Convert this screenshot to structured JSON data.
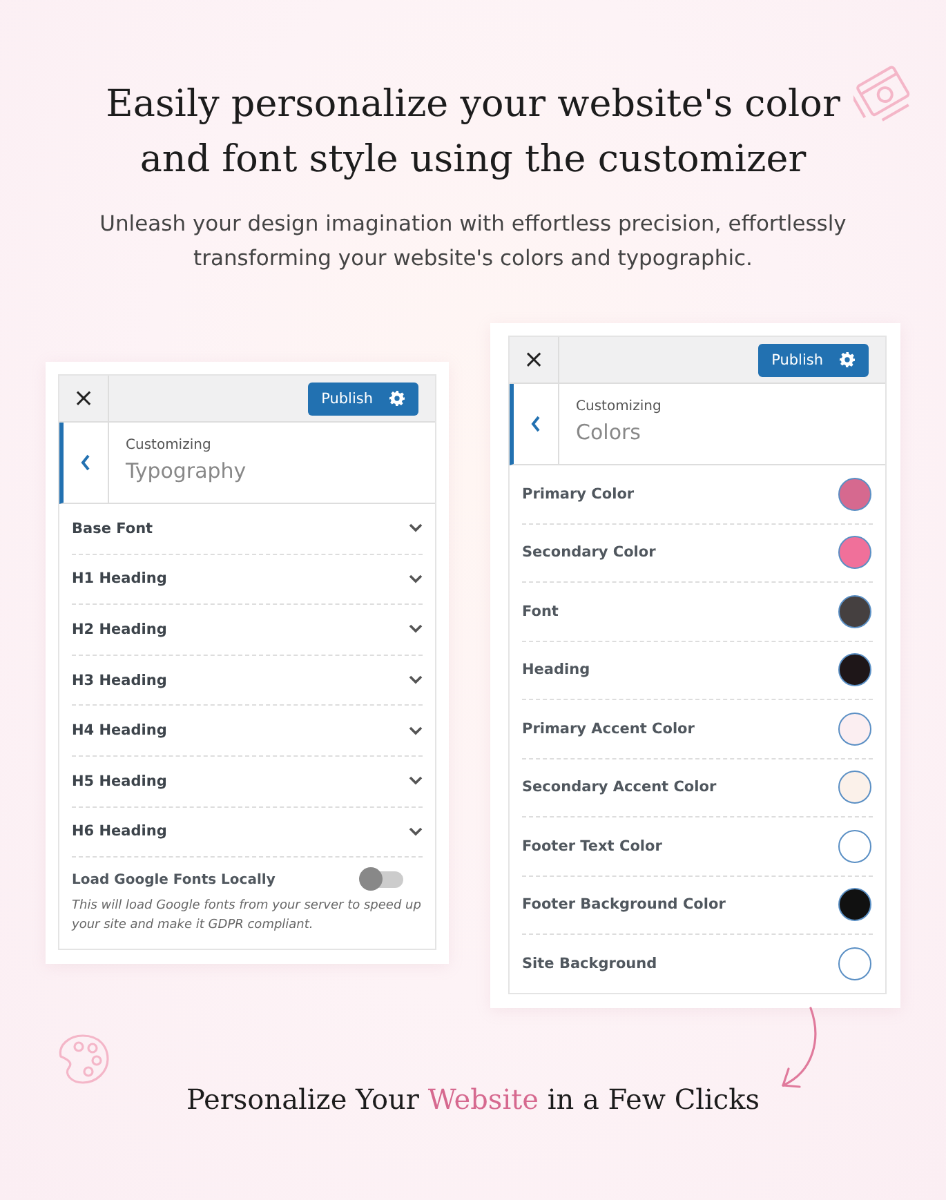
{
  "heading": "Easily personalize your website's color and font style using the customizer",
  "subheading": "Unleash your design imagination with effortless precision, effortlessly transforming your website's colors and typographic.",
  "typography_panel": {
    "close": "×",
    "publish": "Publish",
    "context": "Customizing",
    "title": "Typography",
    "items": [
      {
        "label": "Base Font",
        "expanded": false
      },
      {
        "label": "H1 Heading",
        "expanded": false
      },
      {
        "label": "H2 Heading",
        "expanded": false
      },
      {
        "label": "H3 Heading",
        "expanded": false
      },
      {
        "label": "H4 Heading",
        "expanded": false
      },
      {
        "label": "H5 Heading",
        "expanded": false
      },
      {
        "label": "H6 Heading",
        "expanded": false
      }
    ],
    "toggle": {
      "label": "Load Google Fonts Locally",
      "on": false,
      "description": "This will load Google fonts from your server to speed up your site and make it GDPR compliant."
    }
  },
  "colors_panel": {
    "close": "×",
    "publish": "Publish",
    "context": "Customizing",
    "title": "Colors",
    "items": [
      {
        "label": "Primary Color",
        "color": "#d6698f"
      },
      {
        "label": "Secondary Color",
        "color": "#f0709a"
      },
      {
        "label": "Font",
        "color": "#454040"
      },
      {
        "label": "Heading",
        "color": "#1e1618"
      },
      {
        "label": "Primary Accent Color",
        "color": "#fbeef1"
      },
      {
        "label": "Secondary Accent Color",
        "color": "#fbf1ea"
      },
      {
        "label": "Footer Text Color",
        "color": "#ffffff"
      },
      {
        "label": "Footer Background Color",
        "color": "#111111"
      },
      {
        "label": "Site Background",
        "color": "#ffffff"
      }
    ]
  },
  "caption": {
    "before": "Personalize Your ",
    "highlight": "Website",
    "after": " in a Few Clicks"
  }
}
